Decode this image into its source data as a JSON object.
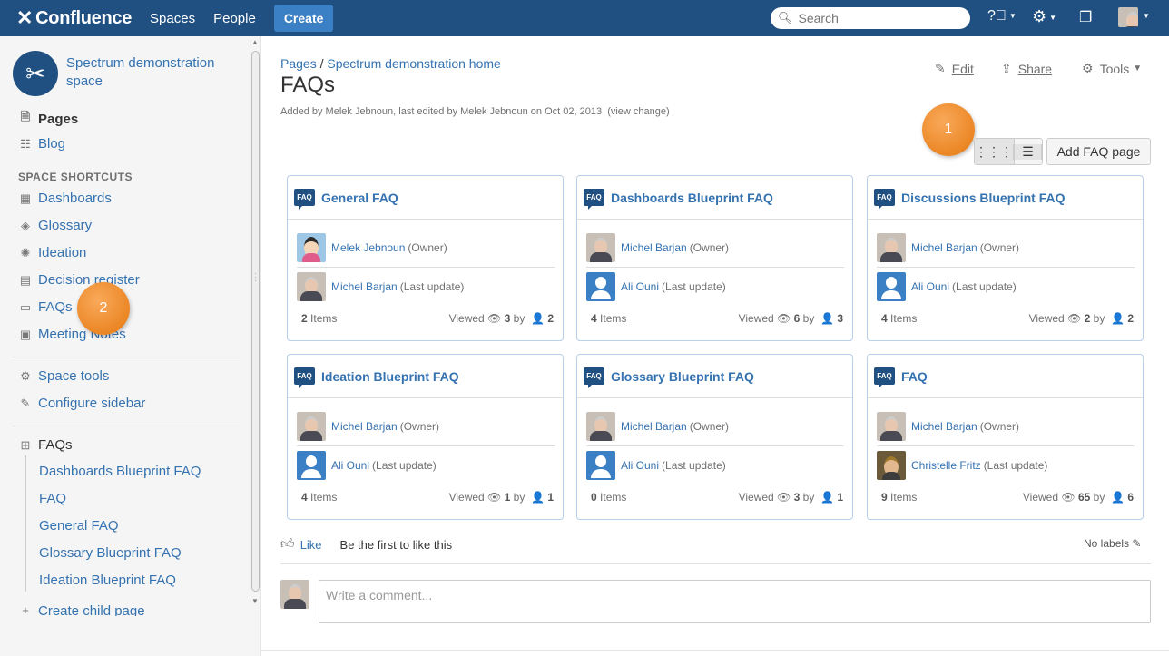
{
  "topnav": {
    "logo": "Confluence",
    "spaces": "Spaces",
    "people": "People",
    "create": "Create",
    "search_placeholder": "Search"
  },
  "sidebar": {
    "space_name": "Spectrum demonstration space",
    "pages": "Pages",
    "blog": "Blog",
    "shortcuts_heading": "SPACE SHORTCUTS",
    "shortcuts": [
      "Dashboards",
      "Glossary",
      "Ideation",
      "Decision register",
      "FAQs",
      "Meeting Notes"
    ],
    "space_tools": "Space tools",
    "configure_sidebar": "Configure sidebar",
    "tree_root": "FAQs",
    "tree_children": [
      "Dashboards Blueprint FAQ",
      "FAQ",
      "General FAQ",
      "Glossary Blueprint FAQ",
      "Ideation Blueprint FAQ"
    ],
    "create_child": "Create child page"
  },
  "page": {
    "breadcrumb_pages": "Pages",
    "breadcrumb_sep": "/",
    "breadcrumb_home": "Spectrum demonstration home",
    "title": "FAQs",
    "byline": "Added by Melek Jebnoun, last edited by Melek Jebnoun on Oct 02, 2013",
    "view_change": "(view change)",
    "edit": "Edit",
    "share": "Share",
    "tools": "Tools"
  },
  "callouts": [
    "1",
    "2"
  ],
  "toolbar": {
    "add_faq": "Add FAQ page"
  },
  "cards": [
    {
      "title": "General FAQ",
      "owner": "Melek Jebnoun",
      "owner_role": "(Owner)",
      "owner_avatar": "girl",
      "updater": "Michel Barjan",
      "updater_role": "(Last update)",
      "updater_avatar": "old",
      "items": "2",
      "items_label": "Items",
      "viewed": "3",
      "by": "2"
    },
    {
      "title": "Dashboards Blueprint FAQ",
      "owner": "Michel Barjan",
      "owner_role": "(Owner)",
      "owner_avatar": "old",
      "updater": "Ali Ouni",
      "updater_role": "(Last update)",
      "updater_avatar": "def",
      "items": "4",
      "items_label": "Items",
      "viewed": "6",
      "by": "3"
    },
    {
      "title": "Discussions Blueprint FAQ",
      "owner": "Michel Barjan",
      "owner_role": "(Owner)",
      "owner_avatar": "old",
      "updater": "Ali Ouni",
      "updater_role": "(Last update)",
      "updater_avatar": "def",
      "items": "4",
      "items_label": "Items",
      "viewed": "2",
      "by": "2"
    },
    {
      "title": "Ideation Blueprint FAQ",
      "owner": "Michel Barjan",
      "owner_role": "(Owner)",
      "owner_avatar": "old",
      "updater": "Ali Ouni",
      "updater_role": "(Last update)",
      "updater_avatar": "def",
      "items": "4",
      "items_label": "Items",
      "viewed": "1",
      "by": "1"
    },
    {
      "title": "Glossary Blueprint FAQ",
      "owner": "Michel Barjan",
      "owner_role": "(Owner)",
      "owner_avatar": "old",
      "updater": "Ali Ouni",
      "updater_role": "(Last update)",
      "updater_avatar": "def",
      "items": "0",
      "items_label": "Items",
      "viewed": "3",
      "by": "1"
    },
    {
      "title": "FAQ",
      "owner": "Michel Barjan",
      "owner_role": "(Owner)",
      "owner_avatar": "old",
      "updater": "Christelle Fritz",
      "updater_role": "(Last update)",
      "updater_avatar": "cf",
      "items": "9",
      "items_label": "Items",
      "viewed": "65",
      "by": "6"
    }
  ],
  "labels": {
    "viewed": "Viewed",
    "by": "by",
    "faq_badge": "FAQ"
  },
  "footer": {
    "like": "Like",
    "first_like": "Be the first to like this",
    "no_labels": "No labels",
    "comment_placeholder": "Write a comment..."
  }
}
